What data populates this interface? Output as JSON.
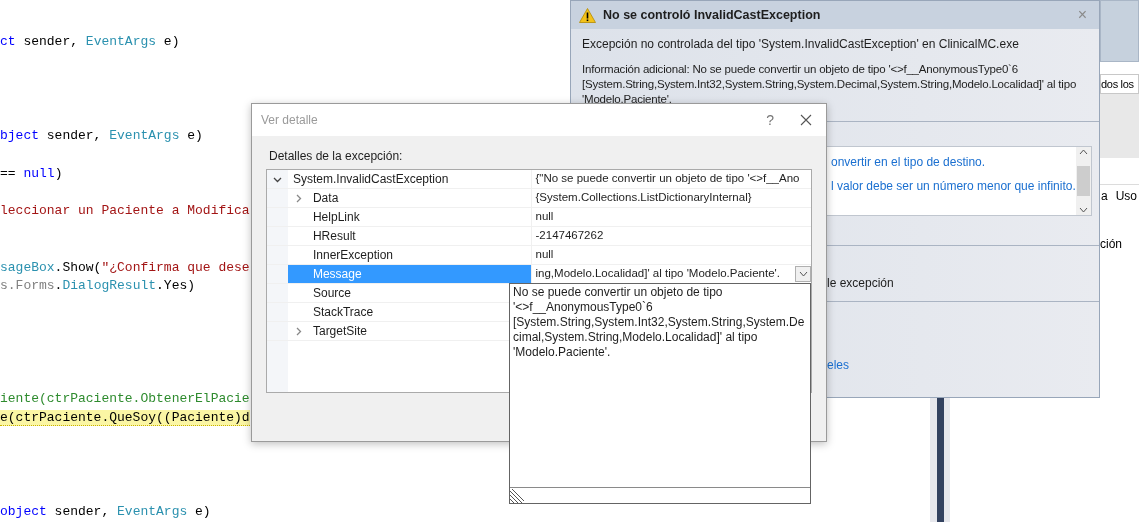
{
  "code_editor": {
    "lines": [
      {
        "highlighted": false,
        "tokens": [
          {
            "text": "ct",
            "kind": "keyword"
          },
          {
            "text": " sender, ",
            "kind": "plain"
          },
          {
            "text": "EventArgs",
            "kind": "type"
          },
          {
            "text": " e)",
            "kind": "plain"
          }
        ]
      },
      {
        "highlighted": false,
        "tokens": [
          {
            "text": "bject",
            "kind": "keyword"
          },
          {
            "text": " sender, ",
            "kind": "plain"
          },
          {
            "text": "EventArgs",
            "kind": "type"
          },
          {
            "text": " e)",
            "kind": "plain"
          }
        ]
      },
      {
        "highlighted": false,
        "tokens": [
          {
            "text": "== ",
            "kind": "plain"
          },
          {
            "text": "null",
            "kind": "keyword"
          },
          {
            "text": ")",
            "kind": "plain"
          }
        ]
      },
      {
        "highlighted": false,
        "tokens": [
          {
            "text": "leccionar un Paciente a Modifica",
            "kind": "string"
          }
        ]
      },
      {
        "highlighted": false,
        "tokens": [
          {
            "text": "sageBox",
            "kind": "type"
          },
          {
            "text": ".Show(",
            "kind": "plain"
          },
          {
            "text": "\"¿Confirma que dese",
            "kind": "string"
          }
        ]
      },
      {
        "highlighted": false,
        "tokens": [
          {
            "text": "s.Forms",
            "kind": "namespace"
          },
          {
            "text": ".",
            "kind": "plain"
          },
          {
            "text": "DialogResult",
            "kind": "type"
          },
          {
            "text": ".Yes)",
            "kind": "plain"
          }
        ]
      },
      {
        "highlighted": false,
        "tokens": [
          {
            "text": "iente(ctrPaciente.ObtenerElPacie",
            "kind": "comment"
          }
        ]
      },
      {
        "highlighted": true,
        "tokens": [
          {
            "text": "e(ctrPaciente.QueSoy((Paciente)d",
            "kind": "plain"
          }
        ]
      },
      {
        "highlighted": false,
        "tokens": [
          {
            "text": "object",
            "kind": "keyword"
          },
          {
            "text": " sender, ",
            "kind": "plain"
          },
          {
            "text": "EventArgs",
            "kind": "type"
          },
          {
            "text": " e)",
            "kind": "plain"
          }
        ]
      }
    ]
  },
  "right_pane": {
    "field": "dos los",
    "columns": [
      "a",
      "Uso"
    ],
    "text": "ción"
  },
  "exception_window": {
    "title": "No se controló InvalidCastException",
    "close": "×",
    "summary": "Excepción no controlada del tipo 'System.InvalidCastException' en ClinicalMC.exe",
    "details": "Información adicional: No se puede convertir un objeto de tipo '<>f__AnonymousType0`6 [System.String,System.Int32,System.String,System.Decimal,System.String,Modelo.Localidad]' al tipo 'Modelo.Paciente'.",
    "messages": [
      "onvertir en el tipo de destino.",
      "l valor debe ser un número menor que infinito."
    ],
    "section_text": "le excepción",
    "link": "eles"
  },
  "detail_dialog": {
    "title": "Ver detalle",
    "help": "?",
    "label": "Detalles de la excepción:",
    "tree": [
      {
        "name": "System.InvalidCastException",
        "value": "{\"No se puede convertir un objeto de tipo '<>f__Ano",
        "expanded": true,
        "selected": false,
        "children": [
          {
            "name": "Data",
            "value": "{System.Collections.ListDictionaryInternal}",
            "expanded": false,
            "selected": false
          },
          {
            "name": "HelpLink",
            "value": "null",
            "selected": false
          },
          {
            "name": "HResult",
            "value": "-2147467262",
            "selected": false
          },
          {
            "name": "InnerException",
            "value": "null",
            "selected": false
          },
          {
            "name": "Message",
            "value": "ing,Modelo.Localidad]' al tipo 'Modelo.Paciente'.",
            "selected": true
          },
          {
            "name": "Source",
            "selected": false
          },
          {
            "name": "StackTrace",
            "selected": false
          },
          {
            "name": "TargetSite",
            "expanded": false,
            "selected": false
          }
        ]
      }
    ],
    "value_editor": {
      "text": "No se puede convertir un objeto de tipo '<>f__AnonymousType0`6 [System.String,System.Int32,System.String,System.Decimal,System.String,Modelo.Localidad]' al tipo 'Modelo.Paciente'."
    }
  }
}
